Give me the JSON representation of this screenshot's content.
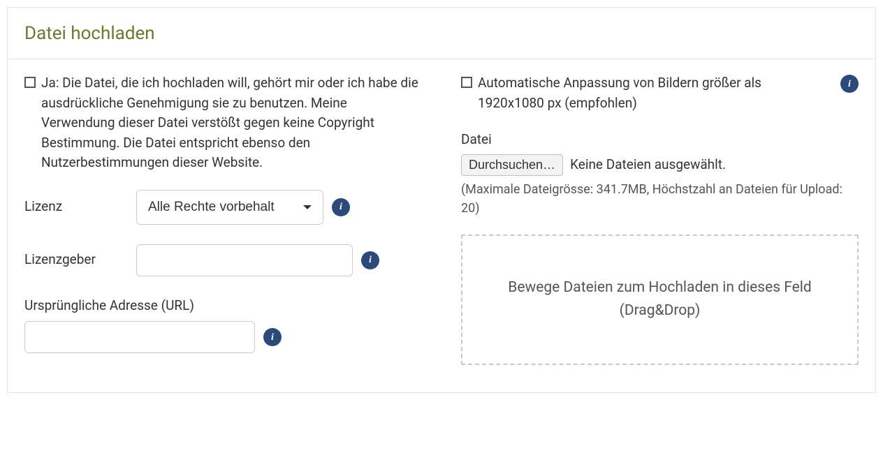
{
  "panel": {
    "title": "Datei hochladen"
  },
  "left": {
    "ownership_checkbox_label": "Ja: Die Datei, die ich hochladen will, gehört mir oder ich habe die ausdrückliche Genehmigung sie zu benutzen. Meine Verwendung dieser Datei verstößt gegen keine Copyright Bestimmung. Die Datei entspricht ebenso den Nutzerbestimmungen dieser Website.",
    "license_label": "Lizenz",
    "license_selected": "Alle Rechte vorbehalt",
    "licensor_label": "Lizenzgeber",
    "licensor_value": "",
    "original_url_label": "Ursprüngliche Adresse (URL)",
    "original_url_value": ""
  },
  "right": {
    "autoresize_checkbox_label": "Automatische Anpassung von Bildern größer als 1920x1080 px (empfohlen)",
    "file_label": "Datei",
    "browse_button": "Durchsuchen…",
    "file_status": "Keine Dateien ausgewählt.",
    "file_hint": "(Maximale Dateigrösse: 341.7MB, Höchstzahl an Dateien für Upload: 20)",
    "dropzone_text": "Bewege Dateien zum Hochladen in dieses Feld (Drag&Drop)"
  },
  "icons": {
    "info_glyph": "i"
  }
}
